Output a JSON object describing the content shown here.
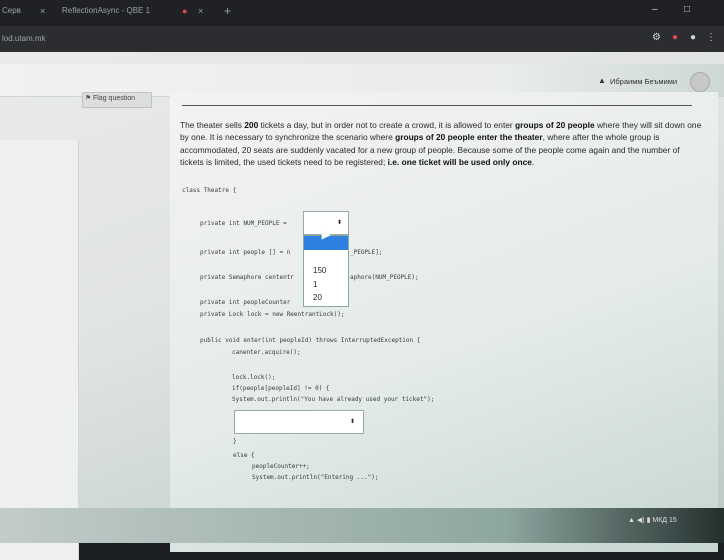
{
  "browser": {
    "tabs": [
      {
        "label": "Серв"
      },
      {
        "label": "ReflectionAsync - QBE 1"
      }
    ],
    "url": "lod.utam.mk"
  },
  "header": {
    "user_name": "Ибраимм Беъмими"
  },
  "question": {
    "flag_label": "Flag question",
    "paragraph": [
      {
        "text": "The theater sells ",
        "bold": false
      },
      {
        "text": "200",
        "bold": true
      },
      {
        "text": " tickets a day, but in order not to create a crowd, it is allowed to enter ",
        "bold": false
      },
      {
        "text": "groups of 20 people",
        "bold": true
      },
      {
        "text": " where they will sit down one by one. It is necessary to synchronize the scenario where ",
        "bold": false
      },
      {
        "text": "groups of 20 people enter the theater",
        "bold": true
      },
      {
        "text": ", where after the whole group is accommodated, 20 seats are suddenly vacated for a new group of people. Because some of the people come again and the number of tickets is limited, the used tickets need to be registered; ",
        "bold": false
      },
      {
        "text": "i.e. one ticket will be used only once",
        "bold": true
      },
      {
        "text": ".",
        "bold": false
      }
    ]
  },
  "code": {
    "class_decl": "class Theatre {",
    "field1": "private int NUM_PEOPLE =",
    "field2_a": "private int people [] = n",
    "field2_b": "_PEOPLE];",
    "field3_a": "private Semaphore cententr",
    "field3_b": "aphore(NUM_PEOPLE);",
    "field4": "private int peopleCounter",
    "field5": "private Lock lock = new ReentrantLock();",
    "method_sig": "public void enter(int peopleId) throws InterruptedException {",
    "acquire": "canenter.acquire();",
    "lock_call": "lock.lock();",
    "if_line": "if(people[peopleId] != 0) {",
    "print_used": "System.out.println(\"You have already used your ticket\");",
    "close_brace": "}",
    "else_line": "else {",
    "counter_inc": "peopleCounter++;",
    "print_enter": "System.out.println(\"Entering ...\");"
  },
  "dropdown": {
    "selected": "",
    "options": [
      "150",
      "1",
      "20"
    ]
  },
  "tray": {
    "lang": "МКД",
    "time": "15"
  }
}
